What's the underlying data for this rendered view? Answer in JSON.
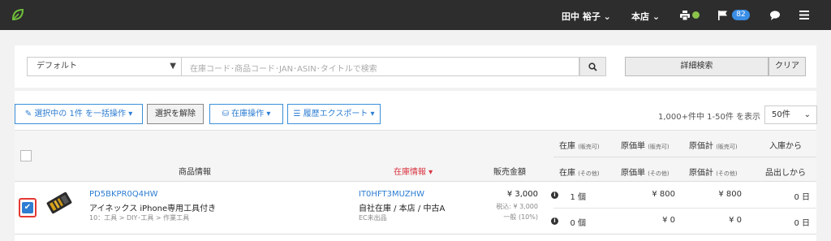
{
  "topbar": {
    "user_label": "田中 裕子 ⌄",
    "store_label": "本店 ⌄",
    "notification_count": "82",
    "status_color": "#8bc34a",
    "accent_color": "#3a8ee6"
  },
  "search": {
    "preset_value": "デフォルト",
    "placeholder": "在庫コード･商品コード･JAN･ASIN･タイトルで検索",
    "advanced_label": "詳細検索",
    "clear_label": "クリア"
  },
  "toolbar": {
    "bulk_label": "選択中の 1件 を一括操作",
    "deselect_label": "選択を解除",
    "stock_ops_label": "在庫操作",
    "export_label": "履歴エクスポート",
    "pager_text": "1,000+件中 1-50件 を表示",
    "per_page": "50件"
  },
  "table": {
    "headers": {
      "product_info": "商品情報",
      "stock_info": "在庫情報",
      "sale_price": "販売金額",
      "stock_sellable": "在庫",
      "stock_sellable_sub": "(販売可)",
      "cost_unit_sellable": "原価単",
      "cost_unit_sellable_sub": "(販売可)",
      "cost_total_sellable": "原価計",
      "cost_total_sellable_sub": "(販売可)",
      "since_arrival": "入庫から",
      "stock_other": "在庫",
      "stock_other_sub": "(その他)",
      "cost_unit_other": "原価単",
      "cost_unit_other_sub": "(その他)",
      "cost_total_other": "原価計",
      "cost_total_other_sub": "(その他)",
      "until_shipment": "品出しから"
    },
    "rows": [
      {
        "product_code": "PD5BKPR0Q4HW",
        "product_title": "アイネックス iPhone専用工具付き",
        "category": "10：工具 > DIY･工具 > 作業工具",
        "stock_code": "IT0HFT3MUZHW",
        "stock_location": "自社在庫 / 本店 / 中古A",
        "channel": "EC未出品",
        "price": "¥ 3,000",
        "tax_included": "税込: ¥ 3,000",
        "tax_class": "一般 (10%)",
        "stock_sellable": "1 個",
        "cost_unit_sellable": "¥ 800",
        "cost_total_sellable": "¥ 800",
        "days_since_arrival": "0 日",
        "stock_other": "0 個",
        "cost_unit_other": "¥ 0",
        "cost_total_other": "¥ 0",
        "days_since_shipment": "0 日"
      }
    ]
  }
}
